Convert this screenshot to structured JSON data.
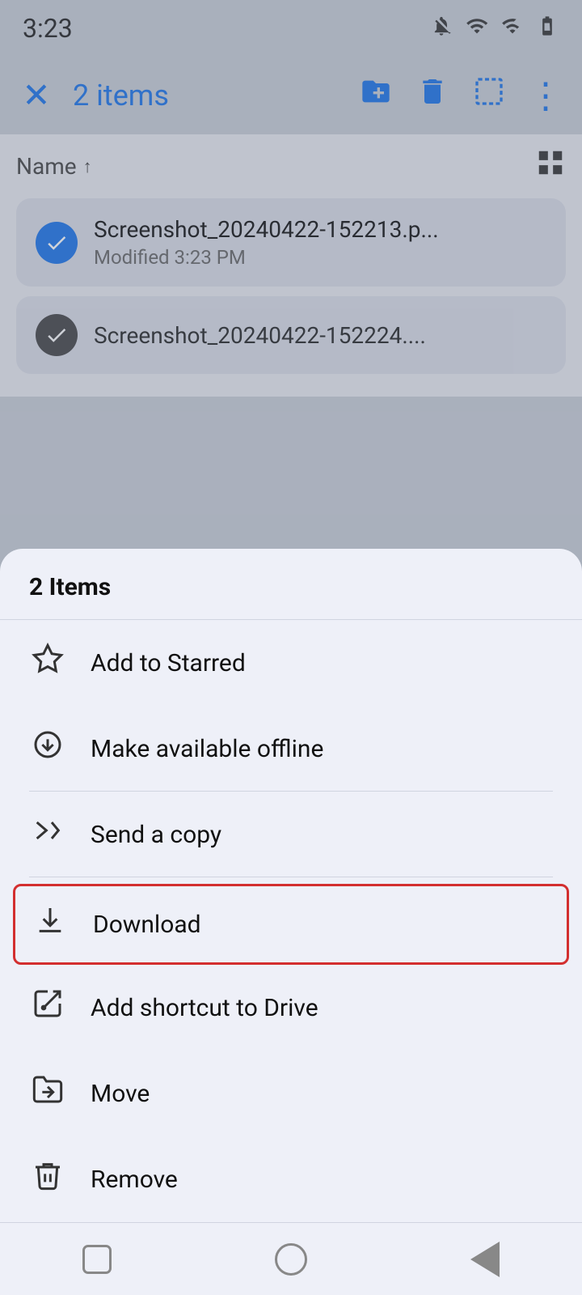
{
  "status_bar": {
    "time": "3:23",
    "icons": [
      "bell-mute-icon",
      "wifi-icon",
      "signal-icon",
      "battery-icon"
    ]
  },
  "action_bar": {
    "close_label": "×",
    "items_count": "2 items",
    "move_icon": "move-icon",
    "delete_icon": "delete-icon",
    "select_all_icon": "select-all-icon",
    "more_icon": "more-icon"
  },
  "file_list": {
    "sort_label": "Name",
    "sort_direction": "↑",
    "files": [
      {
        "name": "Screenshot_20240422-152213.p...",
        "meta": "Modified 3:23 PM",
        "selected": true
      },
      {
        "name": "Screenshot_20240422-152224....",
        "meta": "",
        "selected": true
      }
    ]
  },
  "bottom_sheet": {
    "title": "2 Items",
    "menu_items": [
      {
        "id": "add-starred",
        "icon": "star-icon",
        "label": "Add to Starred",
        "divider": false
      },
      {
        "id": "offline",
        "icon": "offline-icon",
        "label": "Make available offline",
        "divider": true
      },
      {
        "id": "send-copy",
        "icon": "send-icon",
        "label": "Send a copy",
        "divider": true
      },
      {
        "id": "download",
        "icon": "download-icon",
        "label": "Download",
        "divider": false,
        "highlighted": true
      },
      {
        "id": "add-shortcut",
        "icon": "shortcut-icon",
        "label": "Add shortcut to Drive",
        "divider": false
      },
      {
        "id": "move",
        "icon": "move-folder-icon",
        "label": "Move",
        "divider": false
      },
      {
        "id": "remove",
        "icon": "trash-icon",
        "label": "Remove",
        "divider": false
      }
    ]
  },
  "nav_bar": {
    "buttons": [
      "square-nav",
      "circle-nav",
      "back-nav"
    ]
  }
}
